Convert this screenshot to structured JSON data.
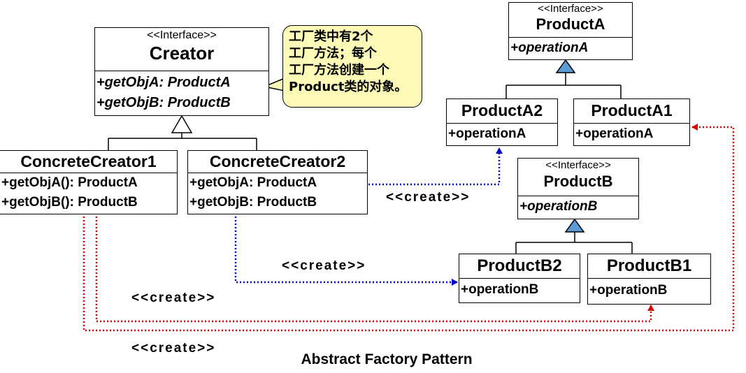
{
  "note": {
    "text": "工厂类中有2个\n工厂方法；每个\n工厂方法创建一个\nProduct类的对象。"
  },
  "classes": {
    "creator": {
      "stereotype": "<<Interface>>",
      "name": "Creator",
      "ops": [
        "+getObjA: ProductA",
        "+getObjB: ProductB"
      ]
    },
    "concrete_creator1": {
      "name": "ConcreteCreator1",
      "ops": [
        "+getObjA(): ProductA",
        "+getObjB(): ProductB"
      ]
    },
    "concrete_creator2": {
      "name": "ConcreteCreator2",
      "ops": [
        "+getObjA: ProductA",
        "+getObjB: ProductB"
      ]
    },
    "product_a": {
      "stereotype": "<<Interface>>",
      "name": "ProductA",
      "ops": [
        "+operationA"
      ]
    },
    "product_a2": {
      "name": "ProductA2",
      "ops": [
        "+operationA"
      ]
    },
    "product_a1": {
      "name": "ProductA1",
      "ops": [
        "+operationA"
      ]
    },
    "product_b": {
      "stereotype": "<<Interface>>",
      "name": "ProductB",
      "ops": [
        "+operationB"
      ]
    },
    "product_b2": {
      "name": "ProductB2",
      "ops": [
        "+operationB"
      ]
    },
    "product_b1": {
      "name": "ProductB1",
      "ops": [
        "+operationB"
      ]
    }
  },
  "labels": {
    "create_a2": "<<create>>",
    "create_b2": "<<create>>",
    "create_b1": "<<create>>",
    "create_a1": "<<create>>"
  },
  "caption": "Abstract Factory Pattern",
  "colors": {
    "blue_dotted": "#0000cc",
    "red_dotted": "#dd0000",
    "triangle_fill": "#5b9bd5",
    "note_fill": "#fdfab7"
  }
}
